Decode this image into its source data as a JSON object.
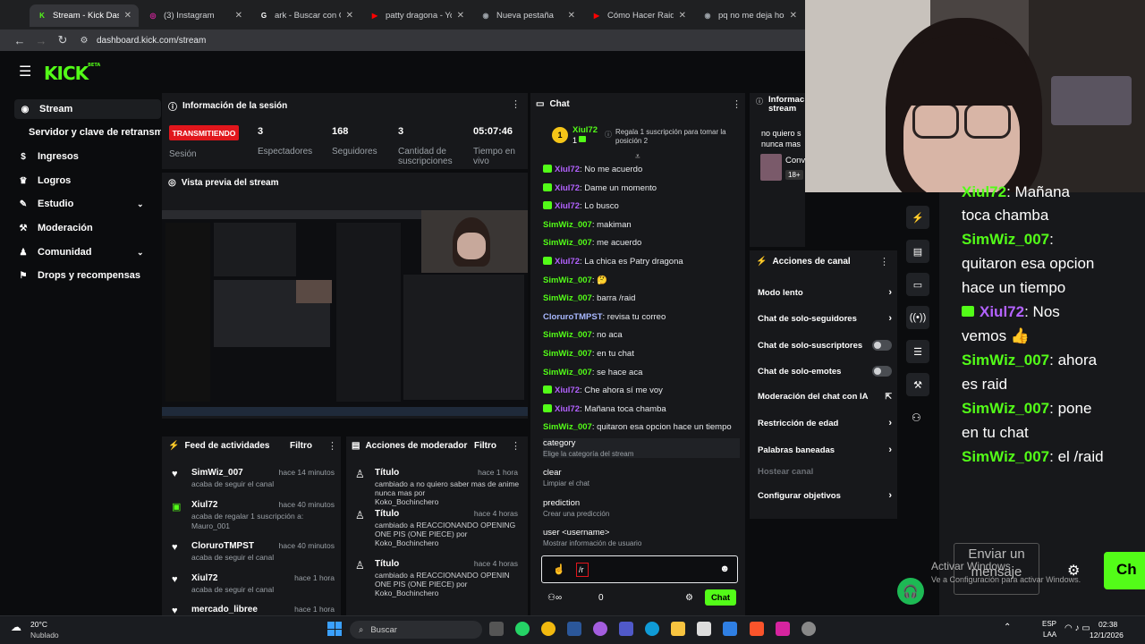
{
  "browser": {
    "tabs": [
      {
        "label": "Stream - Kick Dashbo",
        "color": "#53fc18",
        "glyph": "K",
        "active": true
      },
      {
        "label": "(3) Instagram",
        "color": "#d6249f",
        "glyph": "◎"
      },
      {
        "label": "ark - Buscar con Goo",
        "color": "#ffffff",
        "glyph": "G"
      },
      {
        "label": "patty dragona - YouT",
        "color": "#ff0000",
        "glyph": "▶"
      },
      {
        "label": "Nueva pestaña",
        "color": "#9aa0a6",
        "glyph": "◉"
      },
      {
        "label": "Cómo Hacer Raid",
        "color": "#ff0000",
        "glyph": "▶"
      },
      {
        "label": "pq no me deja hoste",
        "color": "#9aa0a6",
        "glyph": "◉"
      }
    ],
    "url": "dashboard.kick.com/stream"
  },
  "sidebar": {
    "items": [
      {
        "label": "Stream",
        "icon": "stream-icon"
      },
      {
        "label": "Servidor y clave de retransm"
      },
      {
        "label": "Ingresos",
        "icon": "revenue-icon"
      },
      {
        "label": "Logros",
        "icon": "achievements-icon"
      },
      {
        "label": "Estudio",
        "icon": "studio-icon"
      },
      {
        "label": "Moderación",
        "icon": "moderation-icon"
      },
      {
        "label": "Comunidad",
        "icon": "community-icon"
      },
      {
        "label": "Drops y recompensas",
        "icon": "drops-icon"
      }
    ]
  },
  "session": {
    "title": "Información de la sesión",
    "status": "TRANSMITIENDO",
    "status_label": "Sesión",
    "stats": [
      {
        "value": "3",
        "label": "Espectadores"
      },
      {
        "value": "168",
        "label": "Seguidores"
      },
      {
        "value": "3",
        "label": "Cantidad de suscripciones"
      },
      {
        "value": "05:07:46",
        "label": "Tiempo en vivo"
      }
    ]
  },
  "preview": {
    "title": "Vista previa del stream"
  },
  "activity": {
    "title": "Feed de actividades",
    "filter": "Filtro",
    "items": [
      {
        "name": "SimWiz_007",
        "time": "hace 14 minutos",
        "text": "acaba de seguir el canal"
      },
      {
        "name": "Xiul72",
        "time": "hace 40 minutos",
        "text": "acaba de regalar 1 suscripción a:",
        "target": "Mauro_001"
      },
      {
        "name": "CloruroTMPST",
        "time": "hace 40 minutos",
        "text": "acaba de seguir el canal"
      },
      {
        "name": "Xiul72",
        "time": "hace 1 hora",
        "text": "acaba de seguir el canal"
      },
      {
        "name": "mercado_libree",
        "time": "hace 1 hora",
        "text": ""
      }
    ]
  },
  "modactions": {
    "title": "Acciones de moderador",
    "filter": "Filtro",
    "items": [
      {
        "label": "Título",
        "time": "hace 1 hora",
        "text": "cambiado a no quiero saber mas de anime nunca mas por",
        "by": "Koko_Bochinchero"
      },
      {
        "label": "Título",
        "time": "hace 4 horas",
        "text": "cambiado a REACCIONANDO OPENING ONE PIS (ONE PIECE) por",
        "by": "Koko_Bochinchero"
      },
      {
        "label": "Título",
        "time": "hace 4 horas",
        "text": "cambiado a REACCIONANDO OPENIN ONE PIS (ONE PIECE) por",
        "by": "Koko_Bochinchero"
      }
    ]
  },
  "chat": {
    "title": "Chat",
    "pinned_user": "Xiul72",
    "pinned_rank": "1",
    "pinned_count": "1",
    "gift_prompt": "Regala 1 suscripción para tomar la posición 2",
    "messages": [
      {
        "user": "Xiul72",
        "text": "No me acuerdo",
        "color": "#b362ff",
        "badge": true
      },
      {
        "user": "Xiul72",
        "text": "Dame un momento",
        "color": "#b362ff",
        "badge": true
      },
      {
        "user": "Xiul72",
        "text": "Lo busco",
        "color": "#b362ff",
        "badge": true
      },
      {
        "user": "SimWiz_007",
        "text": "makiman",
        "color": "#53fc18"
      },
      {
        "user": "SimWiz_007",
        "text": "me acuerdo",
        "color": "#53fc18"
      },
      {
        "user": "Xiul72",
        "text": "La chica es Patry dragona",
        "color": "#b362ff",
        "badge": true
      },
      {
        "user": "SimWiz_007",
        "text": "🤔",
        "color": "#53fc18"
      },
      {
        "user": "SimWiz_007",
        "text": "barra /raid",
        "color": "#53fc18"
      },
      {
        "user": "CloruroTMPST",
        "text": "revisa tu correo",
        "color": "#a8b8ff"
      },
      {
        "user": "SimWiz_007",
        "text": "no aca",
        "color": "#53fc18"
      },
      {
        "user": "SimWiz_007",
        "text": "en tu chat",
        "color": "#53fc18"
      },
      {
        "user": "SimWiz_007",
        "text": "se hace aca",
        "color": "#53fc18"
      },
      {
        "user": "Xiul72",
        "text": "Che ahora sí me voy",
        "color": "#b362ff",
        "badge": true
      },
      {
        "user": "Xiul72",
        "text": "Mañana toca chamba",
        "color": "#b362ff",
        "badge": true
      },
      {
        "user": "SimWiz_007",
        "text": "quitaron esa opcion hace un tiempo",
        "color": "#53fc18"
      }
    ],
    "commands": [
      {
        "name": "category",
        "desc": "Elige la categoría del stream"
      },
      {
        "name": "clear",
        "desc": "Limpiar el chat"
      },
      {
        "name": "prediction",
        "desc": "Crear una predicción"
      },
      {
        "name": "user <username>",
        "desc": "Mostrar información de usuario"
      }
    ],
    "input_value": "/r",
    "viewers_count": "0",
    "send_label": "Chat"
  },
  "info_partial": {
    "title": "Informac stream",
    "text": "no quiero s nunca mas",
    "sub": "Conv",
    "age": "18+"
  },
  "channel_actions": {
    "title": "Acciones de canal",
    "items": [
      {
        "label": "Modo lento",
        "kind": "arrow"
      },
      {
        "label": "Chat de solo-seguidores",
        "kind": "arrow"
      },
      {
        "label": "Chat de solo-suscriptores",
        "kind": "toggle"
      },
      {
        "label": "Chat de solo-emotes",
        "kind": "toggle"
      },
      {
        "label": "Moderación del chat con IA",
        "kind": "link"
      },
      {
        "label": "Restricción de edad",
        "kind": "arrow"
      },
      {
        "label": "Palabras baneadas",
        "kind": "arrow"
      },
      {
        "label": "Hostear canal",
        "kind": "disabled"
      },
      {
        "label": "Configurar objetivos",
        "kind": "arrow"
      }
    ]
  },
  "overlay_chat": {
    "lines": [
      {
        "user": "Xiul72",
        "text": "Mañana",
        "partial": true
      },
      {
        "text": "toca chamba"
      },
      {
        "user": "SimWiz_007",
        "text": ""
      },
      {
        "text": "quitaron esa opcion"
      },
      {
        "text": "hace un tiempo"
      },
      {
        "user": "Xiul72",
        "text": "Nos",
        "purple": true
      },
      {
        "text": "vemos 👍"
      },
      {
        "user": "SimWiz_007",
        "text": "ahora"
      },
      {
        "text": "es raid"
      },
      {
        "user": "SimWiz_007",
        "text": "pone"
      },
      {
        "text": "en tu chat"
      },
      {
        "user": "SimWiz_007",
        "text": "el /raid"
      }
    ],
    "send_label": "Enviar un mensaje",
    "chat_label": "Ch"
  },
  "windows": {
    "activate": "Activar Windows",
    "activate_sub": "Ve a Configuración para activar Windows.",
    "weather_temp": "20°C",
    "weather_text": "Nublado",
    "search": "Buscar",
    "lang": "ESP",
    "lang2": "LAA",
    "time": "02:38",
    "date": "12/1/2026"
  }
}
